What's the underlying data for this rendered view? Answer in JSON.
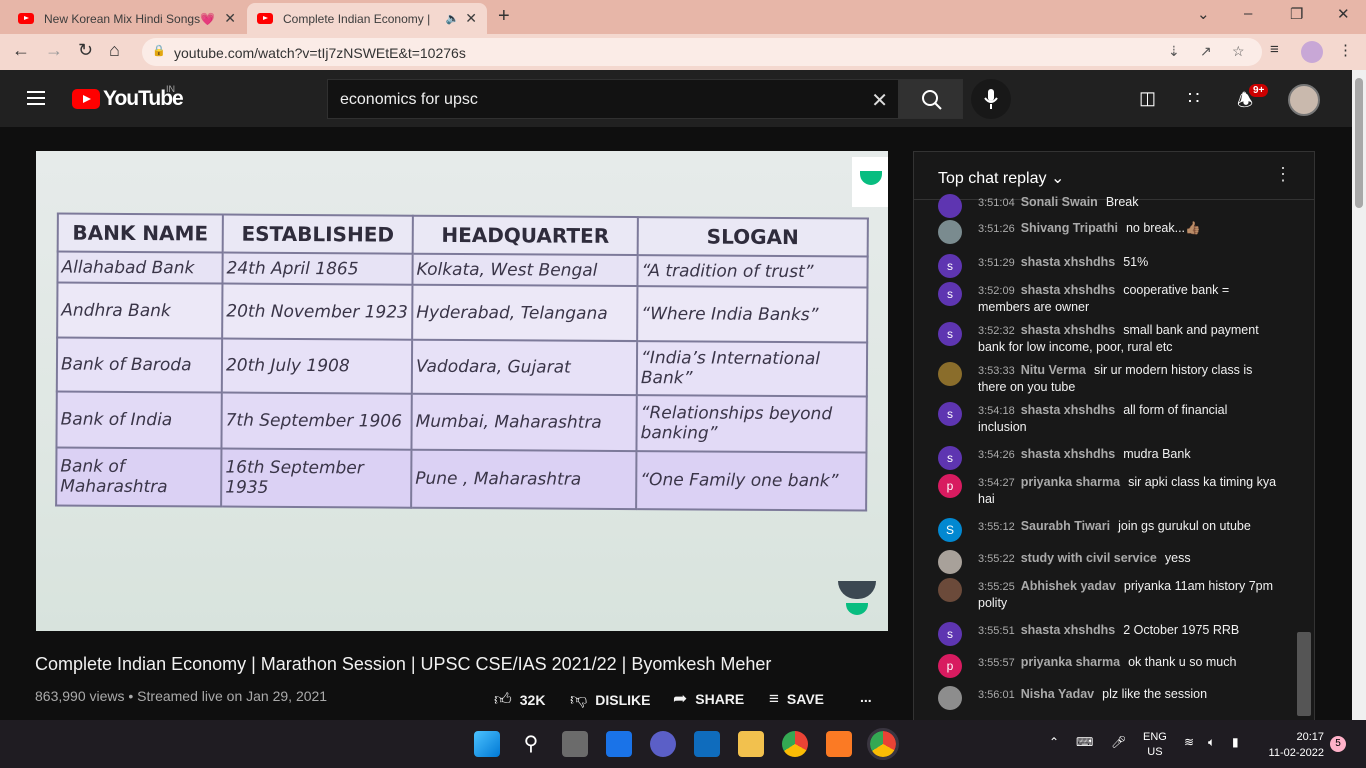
{
  "browser": {
    "tabs": [
      {
        "title": "New Korean Mix Hindi Songs💗",
        "close": "✕"
      },
      {
        "title": "Complete Indian Economy | ",
        "close": "✕"
      }
    ],
    "new_tab": "+",
    "url": "youtube.com/watch?v=tIj7zNSWEtE&t=10276s"
  },
  "youtube": {
    "logo_text": "YouTube",
    "region": "IN",
    "search_query": "economics for upsc",
    "notification_count": "9+"
  },
  "video": {
    "table_headers": [
      "BANK NAME",
      "ESTABLISHED",
      "HEADQUARTER",
      "SLOGAN"
    ],
    "rows": [
      [
        "Allahabad Bank",
        "24th April 1865",
        "Kolkata, West Bengal",
        "“A tradition of trust”"
      ],
      [
        "Andhra Bank",
        "20th November 1923",
        "Hyderabad, Telangana",
        "“Where India Banks”"
      ],
      [
        "Bank of Baroda",
        "20th July 1908",
        "Vadodara, Gujarat",
        "“India’s International Bank”"
      ],
      [
        "Bank of India",
        "7th September 1906",
        "Mumbai, Maharashtra",
        "“Relationships beyond banking”"
      ],
      [
        "Bank of Maharashtra",
        "16th September 1935",
        "Pune , Maharashtra",
        "“One Family one bank”"
      ]
    ],
    "title": "Complete Indian Economy | Marathon Session | UPSC CSE/IAS 2021/22 | Byomkesh Meher",
    "meta": "863,990 views • Streamed live on Jan 29, 2021",
    "actions": {
      "like": "32K",
      "dislike": "DISLIKE",
      "share": "SHARE",
      "save": "SAVE",
      "more": "..."
    }
  },
  "chat": {
    "header": "Top chat replay",
    "messages": [
      {
        "ts": "3:51:04",
        "author": "Sonali Swain",
        "text": "Break",
        "avatar": "",
        "color": "#5e35b1"
      },
      {
        "ts": "3:51:26",
        "author": "Shivang Tripathi",
        "text": "no break...👍🏽",
        "avatar": "",
        "color": "#7a8b8f"
      },
      {
        "ts": "3:51:29",
        "author": "shasta xhshdhs",
        "text": "51%",
        "avatar": "s",
        "color": "#5e35b1"
      },
      {
        "ts": "3:52:09",
        "author": "shasta xhshdhs",
        "text": "cooperative bank = members are owner",
        "avatar": "s",
        "color": "#5e35b1"
      },
      {
        "ts": "3:52:32",
        "author": "shasta xhshdhs",
        "text": "small bank and payment bank for low income, poor, rural etc",
        "avatar": "s",
        "color": "#5e35b1"
      },
      {
        "ts": "3:53:33",
        "author": "Nitu Verma",
        "text": "sir ur modern history class is there on you tube",
        "avatar": "",
        "color": "#8a6d2b"
      },
      {
        "ts": "3:54:18",
        "author": "shasta xhshdhs",
        "text": "all form of financial inclusion",
        "avatar": "s",
        "color": "#5e35b1"
      },
      {
        "ts": "3:54:26",
        "author": "shasta xhshdhs",
        "text": "mudra Bank",
        "avatar": "s",
        "color": "#5e35b1"
      },
      {
        "ts": "3:54:27",
        "author": "priyanka sharma",
        "text": "sir apki class ka timing kya hai",
        "avatar": "p",
        "color": "#d81b60"
      },
      {
        "ts": "3:55:12",
        "author": "Saurabh Tiwari",
        "text": "join gs gurukul on utube",
        "avatar": "S",
        "color": "#0288d1"
      },
      {
        "ts": "3:55:22",
        "author": "study with civil service",
        "text": "yess",
        "avatar": "",
        "color": "#a8a19a"
      },
      {
        "ts": "3:55:25",
        "author": "Abhishek yadav",
        "text": "priyanka 11am history 7pm polity",
        "avatar": "",
        "color": "#6b4a3a"
      },
      {
        "ts": "3:55:51",
        "author": "shasta xhshdhs",
        "text": "2 October 1975 RRB",
        "avatar": "s",
        "color": "#5e35b1"
      },
      {
        "ts": "3:55:57",
        "author": "priyanka sharma",
        "text": "ok thank u so much",
        "avatar": "p",
        "color": "#d81b60"
      },
      {
        "ts": "3:56:01",
        "author": "Nisha Yadav",
        "text": "plz like the session",
        "avatar": "",
        "color": "#8d8d8d"
      }
    ]
  },
  "taskbar": {
    "lang": "ENG",
    "region": "US",
    "time": "20:17",
    "date": "11-02-2022",
    "notifications": "5"
  }
}
